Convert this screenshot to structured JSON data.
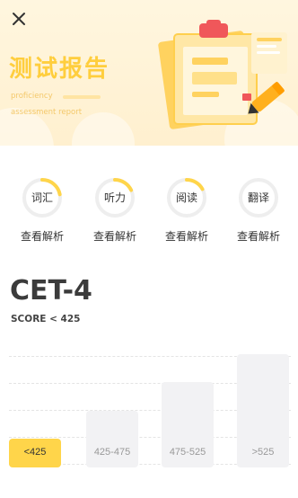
{
  "header": {
    "title": "测试报告",
    "subtitle_line1": "proficiency",
    "subtitle_line2": "assessment report"
  },
  "skills": [
    {
      "label": "词汇",
      "progress": 0.22,
      "link": "查看解析"
    },
    {
      "label": "听力",
      "progress": 0.18,
      "link": "查看解析"
    },
    {
      "label": "阅读",
      "progress": 0.17,
      "link": "查看解析"
    },
    {
      "label": "翻译",
      "progress": 0.0,
      "link": "查看解析"
    }
  ],
  "score": {
    "exam": "CET-4",
    "range_text": "SCORE < 425"
  },
  "chart_data": {
    "type": "bar",
    "categories": [
      "<425",
      "425-475",
      "475-525",
      ">525"
    ],
    "values": [
      1,
      2,
      3,
      4
    ],
    "highlighted": "<425",
    "title": "",
    "xlabel": "",
    "ylabel": ""
  },
  "colors": {
    "accent": "#ffd54a",
    "ring_track": "#eeeeee",
    "bar_inactive": "#f2f2f4",
    "banner_bg": "#fff3d8"
  }
}
